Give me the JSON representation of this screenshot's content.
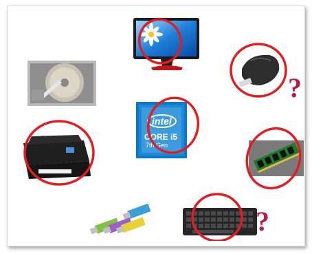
{
  "cpu_sticker": {
    "brand": "intel",
    "line1": "CORE i5",
    "line2": "7th Gen"
  },
  "unknown_marks": {
    "mouse": "?",
    "keyboard": "?"
  },
  "colors": {
    "circle_red": "#e11d21",
    "question_mark": "#b81d45",
    "intel_blue": "#0b79c6",
    "monitor_sky": "#1e7fd8"
  },
  "icons": [
    "monitor-icon",
    "hard-drive-icon",
    "mouse-icon",
    "cpu-icon",
    "printer-icon",
    "ram-icon",
    "usb-drives-icon",
    "keyboard-icon"
  ]
}
